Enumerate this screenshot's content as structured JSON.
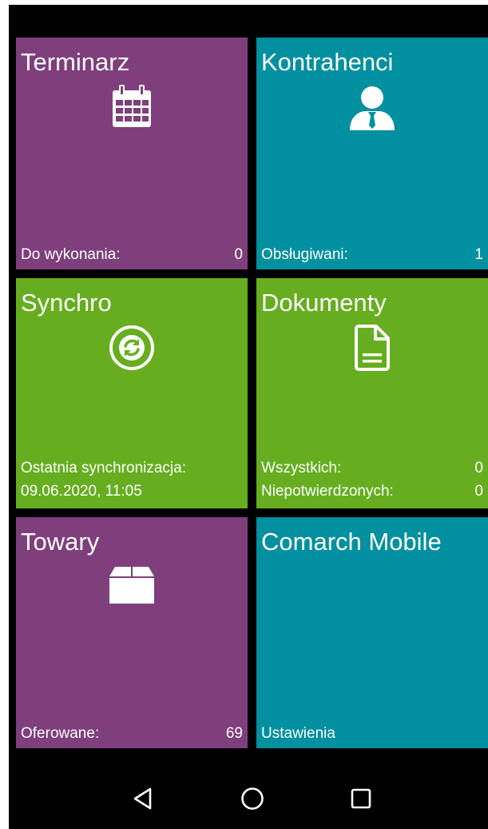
{
  "colors": {
    "purple": "#7e3f7c",
    "teal": "#00909f",
    "green": "#66ae1f",
    "background": "#000000",
    "text": "#ffffff"
  },
  "tiles": {
    "terminarz": {
      "title": "Terminarz",
      "icon": "calendar-icon",
      "stat_label": "Do wykonania:",
      "stat_value": "0"
    },
    "kontrahenci": {
      "title": "Kontrahenci",
      "icon": "user-icon",
      "stat_label": "Obsługiwani:",
      "stat_value": "1"
    },
    "synchro": {
      "title": "Synchro",
      "icon": "sync-icon",
      "stat_label": "Ostatnia synchronizacja:",
      "stat_value": "09.06.2020, 11:05"
    },
    "dokumenty": {
      "title": "Dokumenty",
      "icon": "document-icon",
      "stats": [
        {
          "label": "Wszystkich:",
          "value": "0"
        },
        {
          "label": "Niepotwierdzonych:",
          "value": "0"
        }
      ]
    },
    "towary": {
      "title": "Towary",
      "icon": "box-icon",
      "stat_label": "Oferowane:",
      "stat_value": "69"
    },
    "comarch": {
      "title": "Comarch Mobile",
      "stat_label": "Ustawienia"
    }
  },
  "navbar": {
    "back": "back-icon",
    "home": "home-icon",
    "recents": "recents-icon"
  }
}
